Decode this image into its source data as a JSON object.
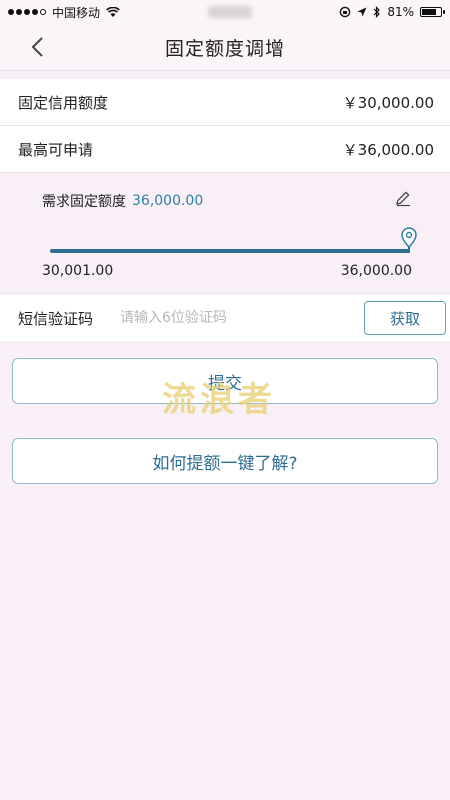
{
  "status_bar": {
    "carrier": "中国移动",
    "battery": "81%",
    "battery_level": 0.81
  },
  "nav": {
    "title": "固定额度调增"
  },
  "info_rows": [
    {
      "label": "固定信用额度",
      "value": "￥30,000.00"
    },
    {
      "label": "最高可申请",
      "value": "￥36,000.00"
    }
  ],
  "slider": {
    "label": "需求固定额度",
    "value": "36,000.00",
    "min_label": "30,001.00",
    "max_label": "36,000.00"
  },
  "sms": {
    "label": "短信验证码",
    "placeholder": "请输入6位验证码",
    "button": "获取"
  },
  "buttons": {
    "submit": "提交",
    "learn": "如何提额一键了解?"
  },
  "watermark": "流浪者",
  "colors": {
    "accent": "#2f6e93",
    "value_blue": "#2f7fa3",
    "background": "#f8f0f6"
  }
}
